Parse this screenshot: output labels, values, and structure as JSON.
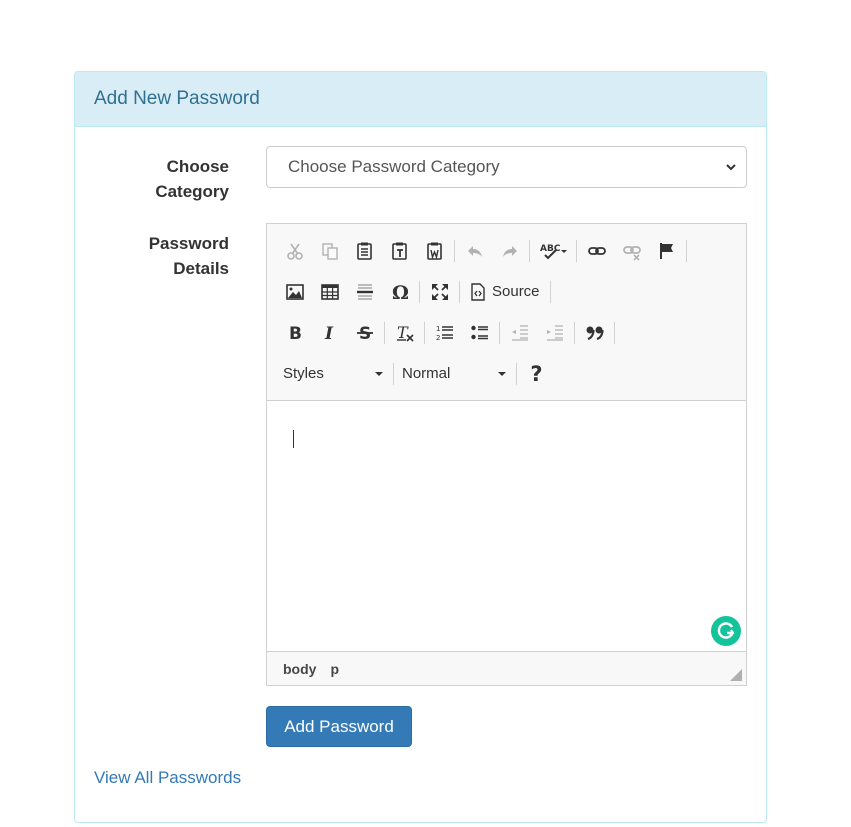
{
  "panel": {
    "title": "Add New Password"
  },
  "form": {
    "category_label_line1": "Choose",
    "category_label_line2": "Category",
    "category_selected": "Choose Password Category",
    "details_label_line1": "Password",
    "details_label_line2": "Details"
  },
  "editor": {
    "toolbar": {
      "source_label": "Source",
      "styles_label": "Styles",
      "format_label": "Normal",
      "help_label": "?"
    },
    "path": [
      "body",
      "p"
    ]
  },
  "actions": {
    "add_button": "Add Password",
    "view_all_link": "View All Passwords"
  },
  "colors": {
    "heading_bg": "#d9edf7",
    "heading_text": "#31708f",
    "primary": "#337ab7",
    "grammarly": "#15c39a"
  }
}
